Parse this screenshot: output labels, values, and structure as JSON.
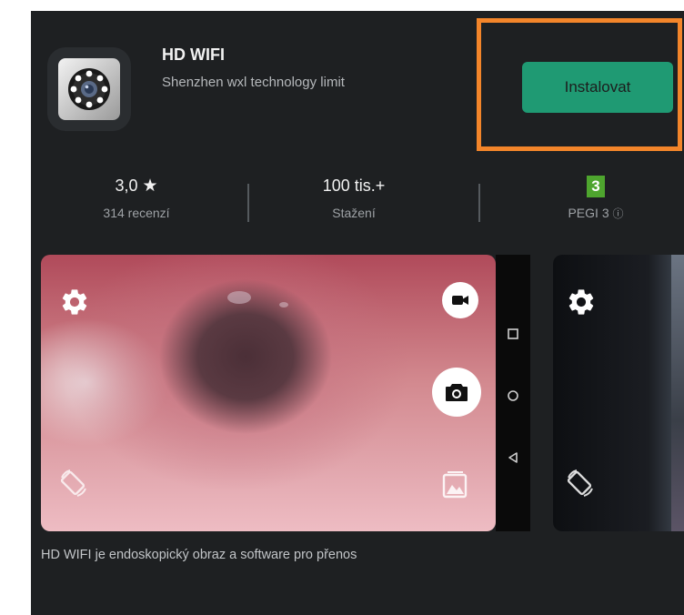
{
  "app": {
    "name": "HD WIFI",
    "developer": "Shenzhen wxl technology limit",
    "install_label": "Instalovat"
  },
  "stats": {
    "rating": "3,0",
    "rating_star": "★",
    "reviews": "314 recenzí",
    "downloads": "100 tis.+",
    "downloads_label": "Stažení",
    "pegi_number": "3",
    "pegi_label": "PEGI 3",
    "pegi_info_icon": "ⓘ"
  },
  "description": "HD WIFI je endoskopický obraz a software pro přenos",
  "icons": [
    "camera-lens-icon",
    "gear-icon",
    "video-camera-icon",
    "camera-icon",
    "rotate-icon",
    "gallery-icon",
    "square-icon",
    "circle-icon",
    "back-triangle-icon",
    "info-icon",
    "star-icon"
  ],
  "colors": {
    "background": "#1e2022",
    "install_button": "#1f9a73",
    "highlight": "#f3852a",
    "pegi": "#4ea52e"
  }
}
